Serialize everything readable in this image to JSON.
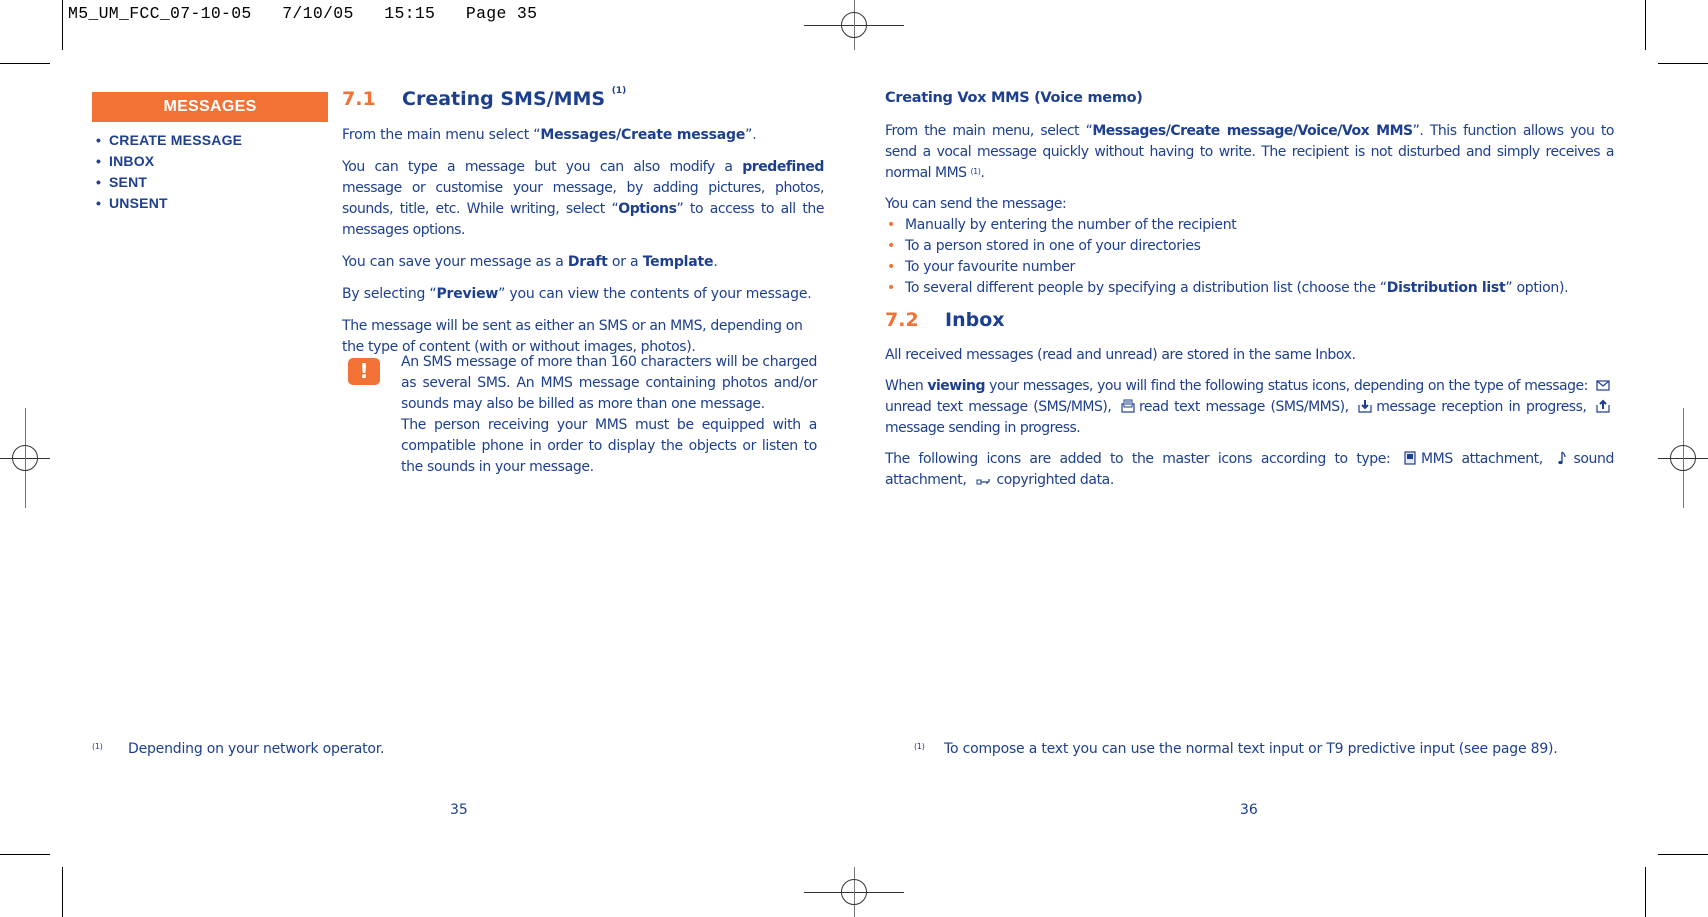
{
  "slug": "M5_UM_FCC_07-10-05   7/10/05   15:15   Page 35",
  "sidebar": {
    "title": "MESSAGES",
    "items": [
      "CREATE MESSAGE",
      "INBOX",
      "SENT",
      "UNSENT"
    ],
    "bullet": "•",
    "accent_color": "#f27236"
  },
  "left": {
    "section": {
      "number": "7.1",
      "title": "Creating SMS/MMS",
      "footnote_ref": "(1)"
    },
    "p1": {
      "a": "From the main menu select “",
      "b": "Messages/Create message",
      "c": "”."
    },
    "p2": {
      "a": "You can type a message but you can also modify a ",
      "b": "predefined",
      "c": " message or customise your message, by adding pictures, photos, sounds, title, etc. While writing, select “",
      "d": "Options",
      "e": "” to access to all the messages options."
    },
    "p3": {
      "a": "You can save your message as a ",
      "b": "Draft",
      "c": " or a ",
      "d": "Template",
      "e": "."
    },
    "p4": {
      "a": "By selecting “",
      "b": "Preview",
      "c": "” you can view the contents of your message."
    },
    "p5": "The message will be sent as either an SMS or an MMS, depending on the type of content (with or without images, photos).",
    "warning": {
      "icon": "!",
      "line1": "An SMS message of more than 160 characters will be charged as several SMS. An MMS message containing photos and/or sounds may also be billed as more than one message.",
      "line2": "The person receiving your MMS must be equipped with a compatible phone in order to display the objects or listen to the sounds in your message."
    },
    "footnote": {
      "marker": "(1)",
      "text": "Depending on your network operator."
    },
    "page_number": "35"
  },
  "right": {
    "vox": {
      "title": "Creating Vox MMS (Voice memo)",
      "p1": {
        "a": "From the main menu, select “",
        "b": "Messages/Create message/Voice/Vox MMS",
        "c": "”. This function allows you to send a vocal message quickly without having to write. The recipient is not disturbed and simply receives a normal MMS ",
        "sup": "(1)",
        "d": "."
      },
      "p2": "You can send the message:",
      "bullets": [
        {
          "text": "Manually by entering the number of the recipient"
        },
        {
          "text": "To a person stored in one of your directories"
        },
        {
          "text": "To your favourite number"
        },
        {
          "a": "To several different people by specifying a distribution list (choose the “",
          "b": "Distribution list",
          "c": "” option)."
        }
      ]
    },
    "section": {
      "number": "7.2",
      "title": "Inbox"
    },
    "inbox_p1": "All received messages (read and unread) are stored in the same Inbox.",
    "inbox_p2": {
      "a": "When ",
      "b": "viewing",
      "c": " your messages, you will find the following status icons, depending on the type of message:",
      "icons": [
        {
          "icon": "unread-envelope-icon",
          "label": "unread text message (SMS/MMS),"
        },
        {
          "icon": "read-envelope-icon",
          "label": "read text message (SMS/MMS),"
        },
        {
          "icon": "receiving-icon",
          "label": "message reception in progress,"
        },
        {
          "icon": "sending-icon",
          "label": "message sending in progress."
        }
      ]
    },
    "inbox_p3": {
      "a": "The following icons are added to the master icons according to type:",
      "icons": [
        {
          "icon": "mms-attachment-icon",
          "label": "MMS attachment,"
        },
        {
          "icon": "sound-attachment-icon",
          "label": "sound attachment,"
        },
        {
          "icon": "copyright-key-icon",
          "label": "copyrighted data."
        }
      ]
    },
    "footnote": {
      "marker": "(1)",
      "text": "To compose a text you can use the normal text input or T9 predictive input (see page 89)."
    },
    "page_number": "36"
  }
}
